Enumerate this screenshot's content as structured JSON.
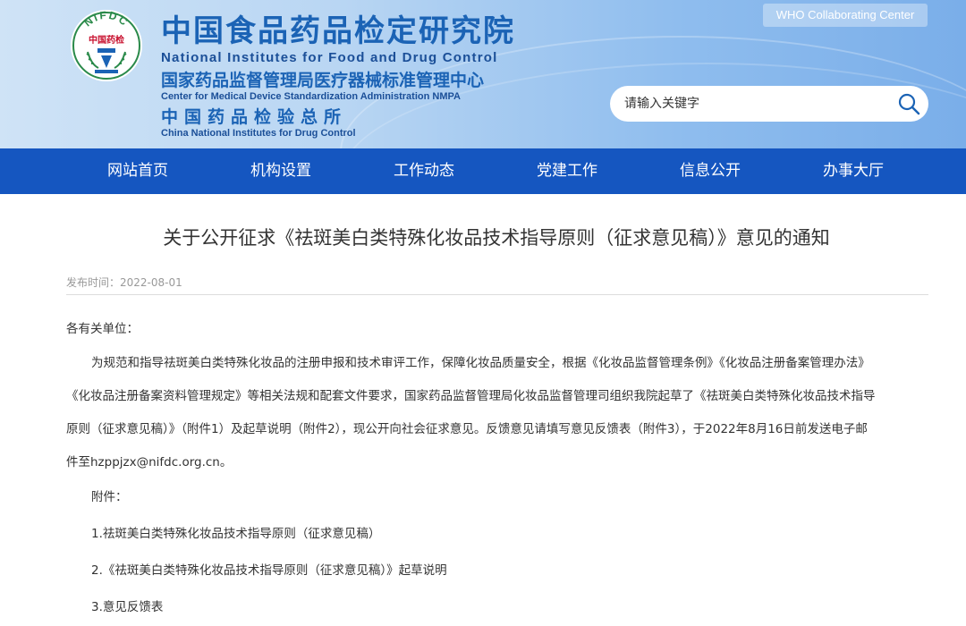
{
  "header": {
    "logo_text_top": "NIFDC",
    "logo_text_mid": "中国药检",
    "title_cn": "中国食品药品检定研究院",
    "title_en": "National Institutes for Food and Drug Control",
    "sub1_cn": "国家药品监督管理局医疗器械标准管理中心",
    "sub1_en": "Center for Medical Device Standardization Administration NMPA",
    "sub2_cn": "中国药品检验总所",
    "sub2_en": "China National Institutes for Drug Control",
    "who_badge": "WHO Collaborating Center",
    "search_placeholder": "请输入关键字",
    "colors": {
      "header_light": "#cfe3f6",
      "header_dark": "#7aaee9",
      "brand_blue": "#1b63b5",
      "nav_blue": "#1556c0"
    }
  },
  "nav": {
    "items": [
      "网站首页",
      "机构设置",
      "工作动态",
      "党建工作",
      "信息公开",
      "办事大厅"
    ]
  },
  "article": {
    "title": "关于公开征求《祛斑美白类特殊化妆品技术指导原则（征求意见稿）》意见的通知",
    "date_label": "发布时间：",
    "date": "2022-08-01",
    "salutation": "各有关单位：",
    "para_lines": [
      "为规范和指导祛斑美白类特殊化妆品的注册申报和技术审评工作，保障化妆品质量安全，根据《化妆品监督管理条例》《化妆品注册备案管理办法》",
      "《化妆品注册备案资料管理规定》等相关法规和配套文件要求，国家药品监督管理局化妆品监督管理司组织我院起草了《祛斑美白类特殊化妆品技术指导",
      "原则（征求意见稿）》（附件1）及起草说明（附件2），现公开向社会征求意见。反馈意见请填写意见反馈表（附件3），于2022年8月16日前发送电子邮",
      "件至hzppjzx@nifdc.org.cn。"
    ],
    "attachments_label": "附件：",
    "attachments": [
      "1.祛斑美白类特殊化妆品技术指导原则（征求意见稿）",
      "2.《祛斑美白类特殊化妆品技术指导原则（征求意见稿）》起草说明",
      "3.意见反馈表"
    ]
  }
}
